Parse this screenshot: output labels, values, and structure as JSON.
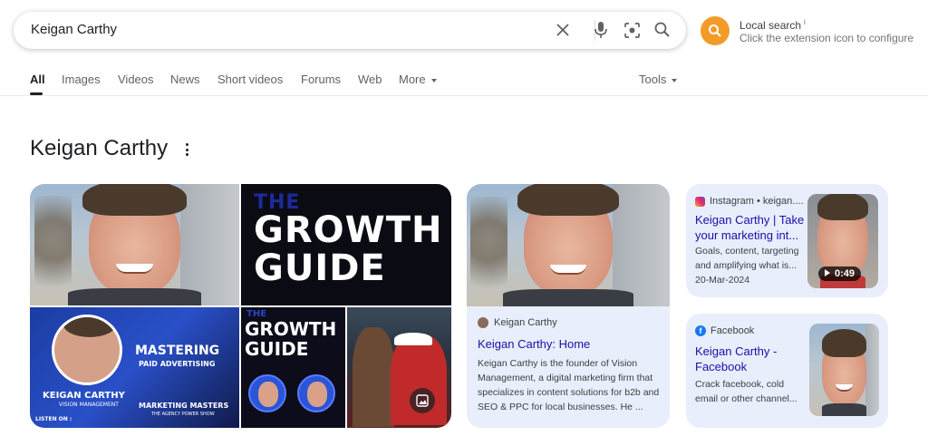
{
  "search": {
    "query": "Keigan Carthy"
  },
  "extension": {
    "title": "Local search",
    "info_mark": "i",
    "subtitle": "Click the extension icon to configure",
    "accent_color": "#f29b27"
  },
  "tabs": [
    {
      "label": "All",
      "active": true
    },
    {
      "label": "Images"
    },
    {
      "label": "Videos"
    },
    {
      "label": "News"
    },
    {
      "label": "Short videos"
    },
    {
      "label": "Forums"
    },
    {
      "label": "Web"
    },
    {
      "label": "More"
    }
  ],
  "tools_label": "Tools",
  "knowledge_panel": {
    "title": "Keigan Carthy"
  },
  "image_grid": {
    "growth_top": {
      "line1": "THE",
      "line2": "GROWTH",
      "line3": "GUIDE"
    },
    "mastering": {
      "line1": "MASTERING",
      "line2": "PAID ADVERTISING",
      "name": "KEIGAN CARTHY",
      "company": "VISION MANAGEMENT",
      "show": "MARKETING MASTERS",
      "show_sub": "THE AGENCY POWER SHOW",
      "listen": "LISTEN ON :"
    },
    "growth_bottom": {
      "line1": "THE",
      "line2": "GROWTH",
      "line3": "GUIDE"
    }
  },
  "web_result": {
    "source": "Keigan Carthy",
    "title": "Keigan Carthy: Home",
    "snippet": "Keigan Carthy is the founder of Vision Management, a digital marketing firm that specializes in content solutions for b2b and SEO & PPC for local businesses. He ..."
  },
  "instagram_result": {
    "source": "Instagram • keigan....",
    "title": "Keigan Carthy | Take your marketing int...",
    "snippet": "Goals, content, targeting and amplifying what is...",
    "date": "20-Mar-2024",
    "duration": "0:49"
  },
  "facebook_result": {
    "source": "Facebook",
    "title": "Keigan Carthy - Facebook",
    "snippet": "Crack facebook, cold email or other channel..."
  },
  "colors": {
    "link": "#1a0dab",
    "card_bg": "#e8eefb"
  }
}
